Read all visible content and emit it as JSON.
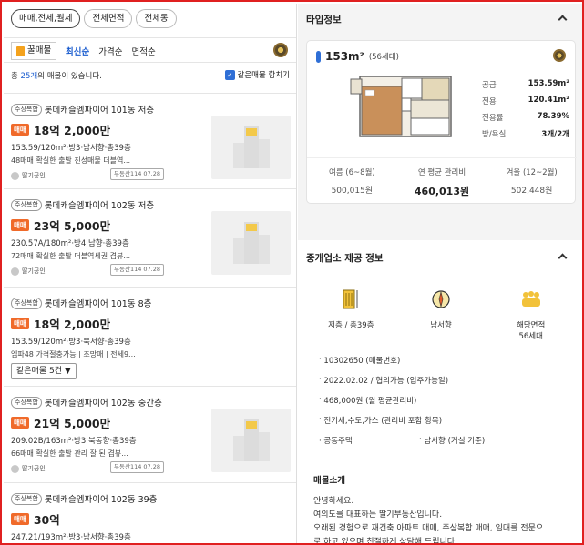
{
  "filters": [
    "매매,전세,월세",
    "전체면적",
    "전체동"
  ],
  "toolbar": {
    "ggul": "꿀매물",
    "sorts": [
      "최신순",
      "가격순",
      "면적순"
    ]
  },
  "count": {
    "prefix": "총 ",
    "num": "25개",
    "suffix": "의 매물이 있습니다.",
    "same_label": "같은매물 합치기"
  },
  "listings": [
    {
      "tag": "주상복합",
      "title": "롯데캐슬엠파이어 101동 저층",
      "badge": "매매",
      "price": "18억 2,000만",
      "spec": "153.59/120m²·방3·남서향·총39층",
      "desc": "48매매 확실한 출발 진성매물 더블역...",
      "agent": "딸기공인",
      "source": "부동산114 07.28"
    },
    {
      "tag": "주상복합",
      "title": "롯데캐슬엠파이어 102동 저층",
      "badge": "매매",
      "price": "23억 5,000만",
      "spec": "230.57A/180m²·방4·남향·총39층",
      "desc": "72매매 확실한 출발 더블역세권 겹뷰...",
      "agent": "딸기공인",
      "source": "부동산114 07.28"
    },
    {
      "tag": "주상복합",
      "title": "롯데캐슬엠파이어 101동 8층",
      "badge": "매매",
      "price": "18억 2,000만",
      "spec": "153.59/120m²·방3·북서향·총39층",
      "desc": "엠파48 가격절충가능 | 조망매 | 전세9...",
      "same": "같은매물 5건 ▼"
    },
    {
      "tag": "주상복합",
      "title": "롯데캐슬엠파이어 102동 중간층",
      "badge": "매매",
      "price": "21억 5,000만",
      "spec": "209.02B/163m²·방3·북동향·총39층",
      "desc": "66매매 확실한 출발 관리 잘 된 겹뷰...",
      "agent": "딸기공인",
      "source": "부동산114 07.28"
    },
    {
      "tag": "주상복합",
      "title": "롯데캐슬엠파이어 102동 39층",
      "badge": "매매",
      "price": "30억",
      "spec": "247.21/193m²·방3·남서향·총39층"
    }
  ],
  "type_info": {
    "header": "타입정보",
    "area": "153m²",
    "households": "(56세대)",
    "specs": [
      {
        "k": "공급",
        "v": "153.59m²"
      },
      {
        "k": "전용",
        "v": "120.41m²"
      },
      {
        "k": "전용률",
        "v": "78.39%"
      },
      {
        "k": "방/욕실",
        "v": "3개/2개"
      }
    ],
    "fees": [
      {
        "k": "여름 (6~8월)",
        "v": "500,015원"
      },
      {
        "k": "연 평균 관리비",
        "v": "460,013원"
      },
      {
        "k": "겨울 (12~2월)",
        "v": "502,448원"
      }
    ]
  },
  "broker": {
    "header": "중개업소 제공 정보",
    "icons": [
      {
        "icon": "floor-icon",
        "label": "저층 / 총39층"
      },
      {
        "icon": "compass-direction-icon",
        "label": "남서향"
      },
      {
        "icon": "households-icon",
        "label": "해당면적",
        "label2": "56세대"
      }
    ],
    "lines": [
      "10302650 (매물번호)",
      "2022.02.02 / 협의가능 (입주가능일)",
      "468,000원 (월 평균관리비)",
      "전기세,수도,가스 (관리비 포함 항목)"
    ],
    "last_left": "공동주택",
    "last_right": "남서향 (거실 기준)",
    "intro_header": "매물소개",
    "intro": [
      "안녕하세요.",
      "여의도를 대표하는 딸기부동산입니다.",
      "오래된 경험으로 재건축 아파트 매매, 주상복합 매매, 임대를 전문으",
      "로 하고 있으며 친절하게 상담해 드립니다."
    ]
  }
}
